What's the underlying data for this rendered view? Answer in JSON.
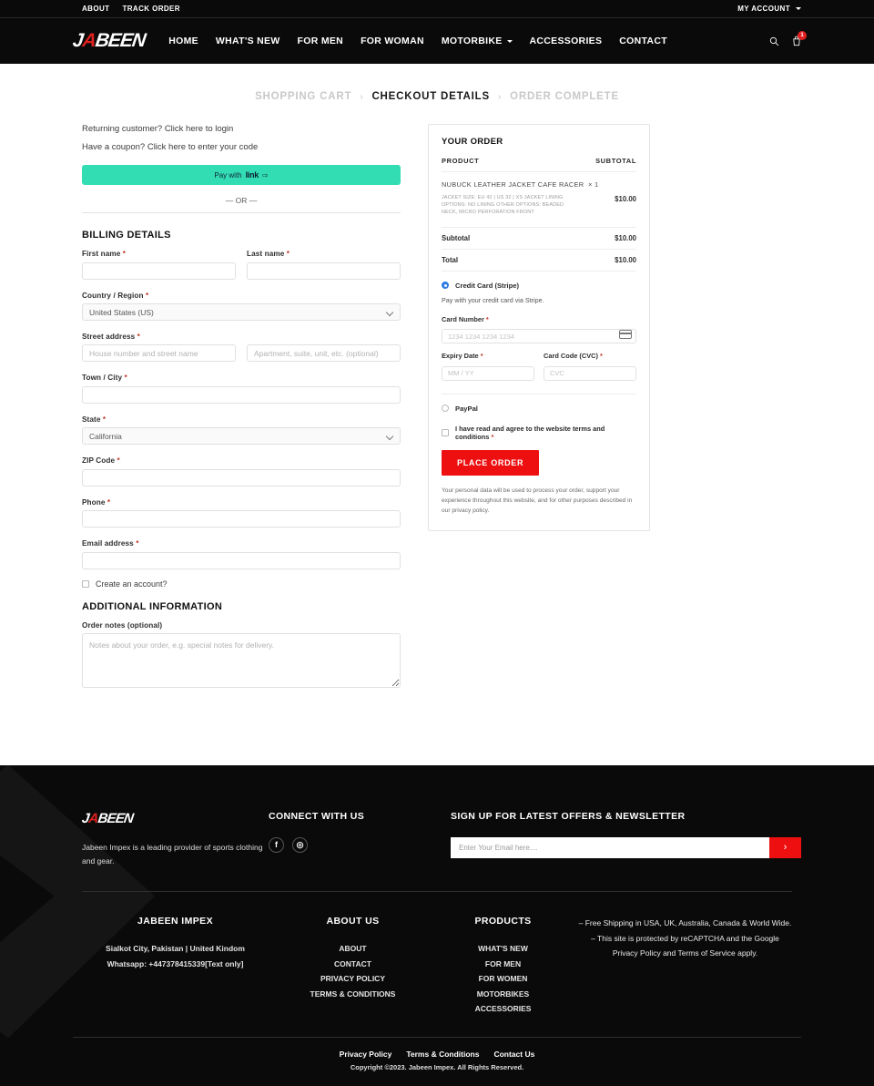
{
  "topbar": {
    "links": [
      {
        "label": "ABOUT"
      },
      {
        "label": "TRACK ORDER"
      }
    ],
    "account": "MY ACCOUNT"
  },
  "header": {
    "logo_main": "J",
    "logo_accent": "A",
    "logo_rest": "BEEN",
    "nav": [
      {
        "label": "HOME",
        "dropdown": false
      },
      {
        "label": "WHAT'S NEW",
        "dropdown": false
      },
      {
        "label": "FOR MEN",
        "dropdown": false
      },
      {
        "label": "FOR WOMAN",
        "dropdown": false
      },
      {
        "label": "MOTORBIKE",
        "dropdown": true
      },
      {
        "label": "ACCESSORIES",
        "dropdown": false
      },
      {
        "label": "CONTACT",
        "dropdown": false
      }
    ],
    "search_icon": "search-icon",
    "cart_icon": "cart-icon",
    "cart_count": "1"
  },
  "breadcrumb": {
    "steps": [
      {
        "label": "SHOPPING CART",
        "active": false
      },
      {
        "label": "CHECKOUT DETAILS",
        "active": true
      },
      {
        "label": "ORDER COMPLETE",
        "active": false
      }
    ],
    "separator": "›"
  },
  "checkout": {
    "login_prompt": "Returning customer? Click here to login",
    "coupon_prompt": "Have a coupon? Click here to enter your code",
    "link_button": {
      "prefix": "Pay with",
      "brand": "link",
      "arrow": "⇨"
    },
    "or_text": "— OR —",
    "billing_heading": "BILLING DETAILS",
    "fields": {
      "first_name": {
        "label": "First name",
        "required": "*",
        "value": "",
        "placeholder": ""
      },
      "last_name": {
        "label": "Last name",
        "required": "*",
        "value": "",
        "placeholder": ""
      },
      "country": {
        "label": "Country / Region",
        "required": "*",
        "value": "United States (US)"
      },
      "street": {
        "label": "Street address",
        "required": "*",
        "value": "",
        "placeholder": "House number and street name"
      },
      "street2": {
        "value": "",
        "placeholder": "Apartment, suite, unit, etc. (optional)"
      },
      "city": {
        "label": "Town / City",
        "required": "*",
        "value": "",
        "placeholder": ""
      },
      "state": {
        "label": "State",
        "required": "*",
        "value": "California"
      },
      "zip": {
        "label": "ZIP Code",
        "required": "*",
        "value": "",
        "placeholder": ""
      },
      "phone": {
        "label": "Phone",
        "required": "*",
        "value": "",
        "placeholder": ""
      },
      "email": {
        "label": "Email address",
        "required": "*",
        "value": "",
        "placeholder": ""
      }
    },
    "create_account_label": "Create an account?",
    "additional_heading": "ADDITIONAL INFORMATION",
    "order_notes_label": "Order notes (optional)",
    "order_notes_value": "",
    "order_notes_placeholder": "Notes about your order, e.g. special notes for delivery."
  },
  "order": {
    "title": "YOUR ORDER",
    "col_product": "PRODUCT",
    "col_subtotal": "SUBTOTAL",
    "items": [
      {
        "name": "NUBUCK LEATHER JACKET CAFE RACER",
        "qty": "× 1",
        "meta": "JACKET SIZE:  EU 42 | US 32 | XS\nJACKET LINING OPTIONS:  NO LINING\nOTHER OPTIONS:  BEADED NECK, MICRO PERFORATION FRONT",
        "price": "$10.00"
      }
    ],
    "subtotal_label": "Subtotal",
    "subtotal_value": "$10.00",
    "total_label": "Total",
    "total_value": "$10.00"
  },
  "payment": {
    "stripe": {
      "label": "Credit Card (Stripe)",
      "selected": true,
      "description": "Pay with your credit card via Stripe.",
      "card_number_label": "Card Number",
      "card_number_required": "*",
      "card_number_placeholder": "1234 1234 1234 1234",
      "card_number_value": "",
      "expiry_label": "Expiry Date",
      "expiry_required": "*",
      "expiry_placeholder": "MM / YY",
      "expiry_value": "",
      "cvc_label": "Card Code (CVC)",
      "cvc_required": "*",
      "cvc_placeholder": "CVC",
      "cvc_value": ""
    },
    "paypal": {
      "label": "PayPal",
      "selected": false
    },
    "terms_label": "I have read and agree to the website terms and conditions",
    "terms_required": "*",
    "place_order_label": "PLACE ORDER",
    "privacy_note": "Your personal data will be used to process your order, support your experience throughout this website, and for other purposes described in our privacy policy."
  },
  "footer": {
    "logo_main": "J",
    "logo_accent": "A",
    "logo_rest": "BEEN",
    "tagline": "Jabeen Impex is a leading provider of sports clothing and gear.",
    "connect_heading": "CONNECT WITH US",
    "socials": [
      {
        "name": "facebook-icon",
        "glyph": "f"
      },
      {
        "name": "instagram-icon",
        "glyph": "◎"
      }
    ],
    "newsletter_heading": "SIGN UP FOR LATEST OFFERS & NEWSLETTER",
    "newsletter_placeholder": "Enter Your Email here....",
    "newsletter_value": "",
    "newsletter_btn": "›",
    "columns": [
      {
        "heading": "JABEEN IMPEX",
        "lines": [
          "Sialkot City, Pakistan | United Kindom",
          "Whatsapp: +447378415339[Text only]"
        ]
      },
      {
        "heading": "ABOUT US",
        "lines": [
          "ABOUT",
          "CONTACT",
          "PRIVACY POLICY",
          "TERMS & CONDITIONS"
        ]
      },
      {
        "heading": "PRODUCTS",
        "lines": [
          "WHAT'S NEW",
          "FOR MEN",
          "FOR WOMEN",
          "MOTORBIKES",
          "ACCESSORIES"
        ]
      },
      {
        "heading": "",
        "lines": [
          "– Free Shipping in USA, UK, Australia, Canada & World Wide.",
          "– This site is protected by reCAPTCHA and the Google Privacy Policy and Terms of Service apply."
        ]
      }
    ],
    "bottom_links": [
      {
        "label": "Privacy Policy"
      },
      {
        "label": "Terms & Conditions"
      },
      {
        "label": "Contact Us"
      }
    ],
    "copyright": "Copyright ©2023. Jabeen Impex. All Rights Reserved."
  }
}
